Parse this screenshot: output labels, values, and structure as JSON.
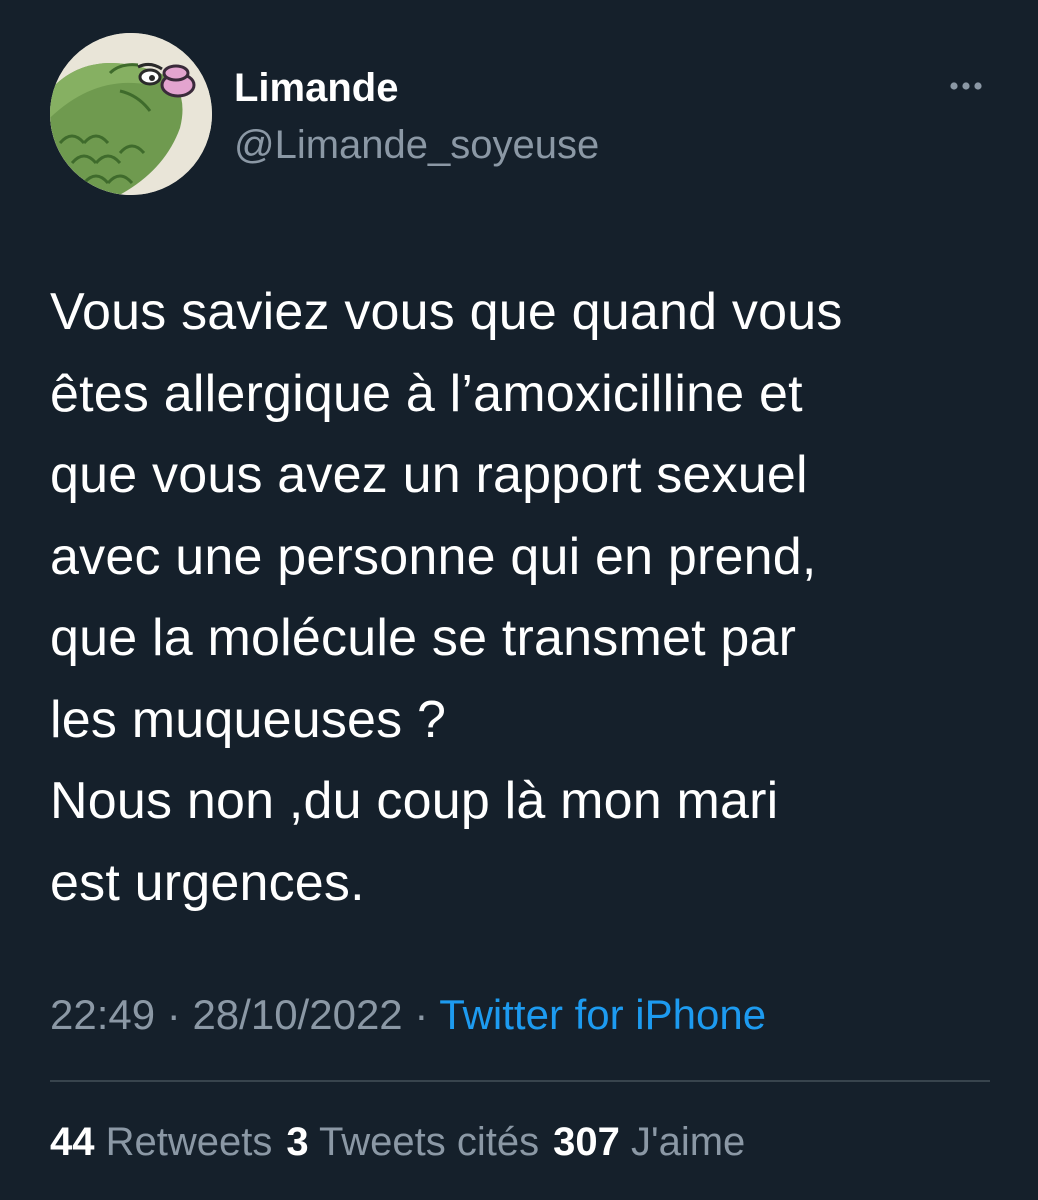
{
  "author": {
    "name": "Limande",
    "handle": "@Limande_soyeuse",
    "avatar_icon": "fish-avatar-icon"
  },
  "more_icon": "more-horizontal-icon",
  "tweet": {
    "text": "Vous saviez vous que quand vous\nêtes allergique à l’amoxicilline et\nque vous avez un rapport sexuel\navec une personne qui en prend,\nque la molécule se transmet par\nles muqueuses ?\nNous non ,du coup là mon mari\nest urgences.",
    "time": "22:49",
    "separator": "·",
    "date": "28/10/2022",
    "source": "Twitter for iPhone"
  },
  "stats": {
    "retweets_count": "44",
    "retweets_label": "Retweets",
    "quotes_count": "3",
    "quotes_label": "Tweets cités",
    "likes_count": "307",
    "likes_label": "J'aime"
  },
  "colors": {
    "background": "#15202b",
    "text_primary": "#ffffff",
    "text_secondary": "#8b98a5",
    "link": "#1d9bf0",
    "divider": "#38444d"
  }
}
